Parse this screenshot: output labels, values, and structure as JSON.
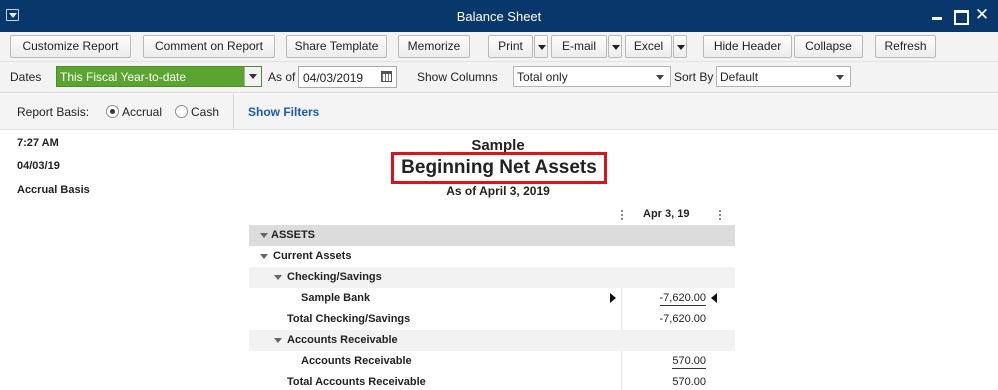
{
  "window": {
    "title": "Balance Sheet",
    "close_glyph": "✕"
  },
  "toolbar": {
    "customize": "Customize Report",
    "comment": "Comment on Report",
    "share": "Share Template",
    "memorize": "Memorize",
    "print": "Print",
    "email": "E-mail",
    "excel": "Excel",
    "hide_header": "Hide Header",
    "collapse": "Collapse",
    "refresh": "Refresh"
  },
  "filters": {
    "dates_label": "Dates",
    "dates_value": "This Fiscal Year-to-date",
    "as_of_label": "As of",
    "as_of_value": "04/03/2019",
    "show_columns_label": "Show Columns",
    "show_columns_value": "Total only",
    "sort_by_label": "Sort By",
    "sort_by_value": "Default"
  },
  "basis": {
    "label": "Report Basis:",
    "accrual": "Accrual",
    "cash": "Cash",
    "selected": "Accrual",
    "show_filters": "Show Filters"
  },
  "report": {
    "time": "7:27 AM",
    "date": "04/03/19",
    "basis": "Accrual Basis",
    "company": "Sample",
    "title": "Beginning Net Assets",
    "subtitle": "As of April 3, 2019",
    "column_header": "Apr 3, 19",
    "rows": [
      {
        "label": "ASSETS",
        "amount": ""
      },
      {
        "label": "Current Assets",
        "amount": ""
      },
      {
        "label": "Checking/Savings",
        "amount": ""
      },
      {
        "label": "Sample Bank",
        "amount": "-7,620.00"
      },
      {
        "label": "Total Checking/Savings",
        "amount": "-7,620.00"
      },
      {
        "label": "Accounts Receivable",
        "amount": ""
      },
      {
        "label": "Accounts Receivable",
        "amount": "570.00"
      },
      {
        "label": "Total Accounts Receivable",
        "amount": "570.00"
      }
    ]
  },
  "colors": {
    "titlebar": "#08386b",
    "dates_highlight": "#5aa52f",
    "title_box": "#d8151b",
    "link": "#1d5aa8"
  }
}
